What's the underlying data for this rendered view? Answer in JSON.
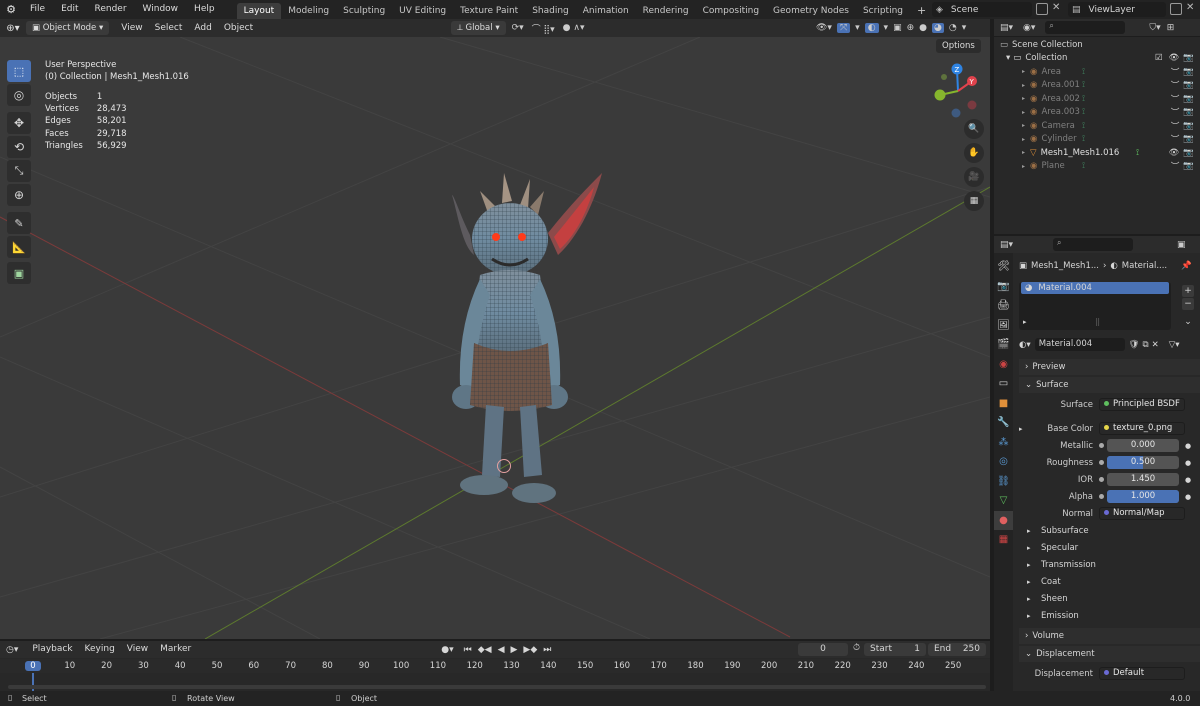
{
  "menu": {
    "items": [
      "File",
      "Edit",
      "Render",
      "Window",
      "Help"
    ]
  },
  "workspaces": {
    "tabs": [
      "Layout",
      "Modeling",
      "Sculpting",
      "UV Editing",
      "Texture Paint",
      "Shading",
      "Animation",
      "Rendering",
      "Compositing",
      "Geometry Nodes",
      "Scripting"
    ],
    "active": "Layout"
  },
  "scene": {
    "name": "Scene",
    "view_layer": "ViewLayer"
  },
  "viewport_header": {
    "mode": "Object Mode",
    "menus": [
      "View",
      "Select",
      "Add",
      "Object"
    ],
    "transform": "Global",
    "options": "Options"
  },
  "overlay_info": {
    "perspective": "User Perspective",
    "collection": "(0) Collection | Mesh1_Mesh1.016"
  },
  "stats": [
    {
      "label": "Objects",
      "value": "1"
    },
    {
      "label": "Vertices",
      "value": "28,473"
    },
    {
      "label": "Edges",
      "value": "58,201"
    },
    {
      "label": "Faces",
      "value": "29,718"
    },
    {
      "label": "Triangles",
      "value": "56,929"
    }
  ],
  "gizmo": {
    "z": "Z",
    "y": "Y",
    "x": "X"
  },
  "outliner": {
    "root": "Scene Collection",
    "collection": "Collection",
    "items": [
      {
        "name": "Area",
        "dim": true
      },
      {
        "name": "Area.001",
        "dim": true
      },
      {
        "name": "Area.002",
        "dim": true
      },
      {
        "name": "Area.003",
        "dim": true
      },
      {
        "name": "Camera",
        "dim": true
      },
      {
        "name": "Cylinder",
        "dim": true
      },
      {
        "name": "Mesh1_Mesh1.016",
        "dim": false
      },
      {
        "name": "Plane",
        "dim": true
      }
    ]
  },
  "properties": {
    "breadcrumb_object": "Mesh1_Mesh1...",
    "breadcrumb_material": "Material....",
    "slot": "Material.004",
    "material_name": "Material.004",
    "panel_preview": "Preview",
    "panel_surface": "Surface",
    "surface_label": "Surface",
    "surface_value": "Principled BSDF",
    "base_color_label": "Base Color",
    "base_color_value": "texture_0.png",
    "metallic_label": "Metallic",
    "metallic_value": "0.000",
    "roughness_label": "Roughness",
    "roughness_value": "0.500",
    "roughness_fraction": 0.5,
    "ior_label": "IOR",
    "ior_value": "1.450",
    "alpha_label": "Alpha",
    "alpha_value": "1.000",
    "alpha_fraction": 1.0,
    "normal_label": "Normal",
    "normal_value": "Normal/Map",
    "subpanels": [
      "Subsurface",
      "Specular",
      "Transmission",
      "Coat",
      "Sheen",
      "Emission"
    ],
    "panel_volume": "Volume",
    "panel_displacement": "Displacement",
    "displacement_label": "Displacement",
    "displacement_value": "Default"
  },
  "timeline": {
    "menus": [
      "Playback",
      "Keying",
      "View",
      "Marker"
    ],
    "current_frame": "0",
    "start_label": "Start",
    "start_value": "1",
    "end_label": "End",
    "end_value": "250",
    "ticks": [
      "0",
      "10",
      "20",
      "30",
      "40",
      "50",
      "60",
      "70",
      "80",
      "90",
      "100",
      "110",
      "120",
      "130",
      "140",
      "150",
      "160",
      "170",
      "180",
      "190",
      "200",
      "210",
      "220",
      "230",
      "240",
      "250"
    ]
  },
  "statusbar": {
    "select": "Select",
    "rotate": "Rotate View",
    "object": "Object",
    "version": "4.0.0"
  },
  "colors": {
    "accent": "#4a72b5",
    "x_axis": "#e0424c",
    "y_axis": "#86b62d",
    "z_axis": "#2f84e3"
  }
}
